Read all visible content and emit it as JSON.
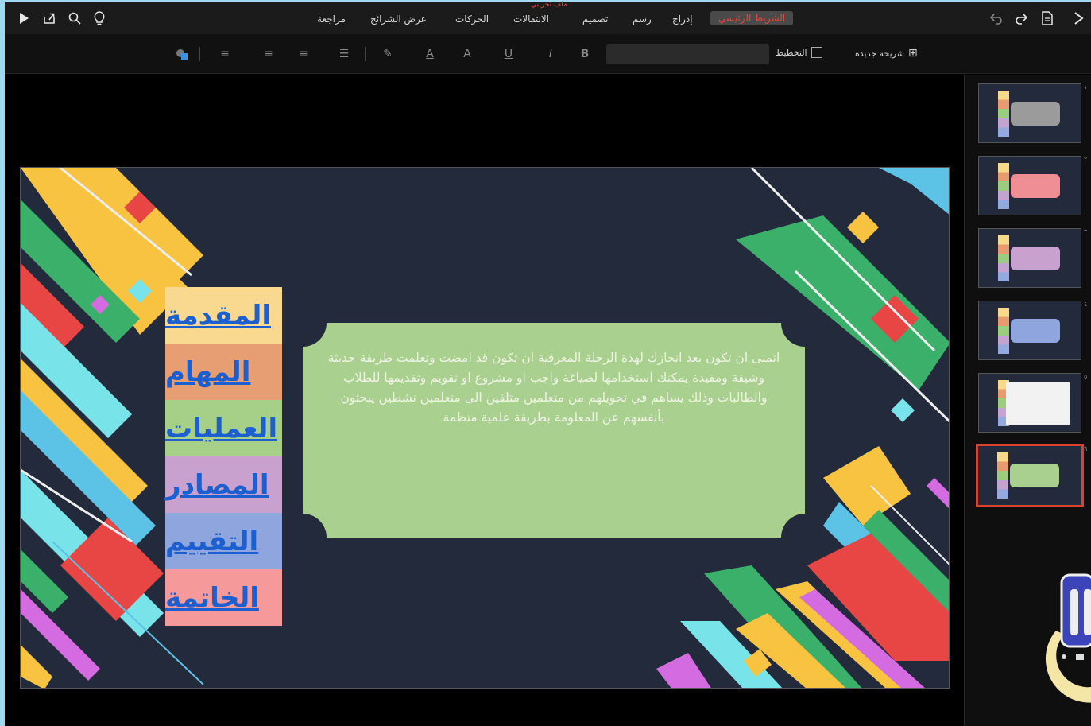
{
  "window": {
    "doc_title": "ملف تجريبي"
  },
  "topbar": {
    "tabs": [
      {
        "label": "الشريط الرئيسي",
        "active": true
      },
      {
        "label": "إدراج",
        "active": false
      },
      {
        "label": "رسم",
        "active": false
      },
      {
        "label": "تصميم",
        "active": false
      },
      {
        "label": "الانتقالات",
        "active": false
      },
      {
        "label": "الحركات",
        "active": false
      },
      {
        "label": "عرض الشرائح",
        "active": false
      },
      {
        "label": "مراجعة",
        "active": false
      }
    ],
    "icons": [
      "play-icon",
      "share-icon",
      "search-icon",
      "lightbulb-icon",
      "undo-icon",
      "redo-icon",
      "document-icon",
      "close-icon"
    ]
  },
  "ribbon": {
    "new_slide": "شريحة جديدة",
    "layout": "التخطيط",
    "bold": "B",
    "italic": "I",
    "underline": "U",
    "font_size_icon": "A",
    "font_color_icon": "A"
  },
  "slide": {
    "toc": [
      {
        "label": "المقدمة",
        "color": "#f9d98f"
      },
      {
        "label": "المهام",
        "color": "#e79e73"
      },
      {
        "label": "العمليات",
        "color": "#a6cf88"
      },
      {
        "label": "المصادر",
        "color": "#c9a1cf"
      },
      {
        "label": "التقييم",
        "color": "#8ea6dd"
      },
      {
        "label": "الخاتمة",
        "color": "#f6999a"
      }
    ],
    "body_text": "اتمنى ان تكون بعد انجازك لهذة الرحلة المعرفية ان تكون قد امضت وتعلمت طريقة حديثة وشيقة ومفيدة يمكنك استخدامها لصياغة واجب او مشروع او تقويم وتقديمها للطلاب والطالبات وذلك يساهم في تحويلهم من متعلمين متلقين الى متعلمين نشطين يبحثون بأنفسهم عن المعلومة بطريقة علمية منظمة",
    "textbox_color": "#a9d08e",
    "background_color": "#222a3b"
  },
  "panel": {
    "thumbnails": [
      {
        "num": "١",
        "box_color": "#9b9b9b",
        "selected": false
      },
      {
        "num": "٢",
        "box_color": "#ef8e95",
        "selected": false
      },
      {
        "num": "٣",
        "box_color": "#c9a1cf",
        "selected": false
      },
      {
        "num": "٤",
        "box_color": "#8ea6dd",
        "selected": false
      },
      {
        "num": "٥",
        "box_color": "#f2f2f2",
        "selected": false
      },
      {
        "num": "٦",
        "box_color": "#a9d08e",
        "selected": true
      }
    ]
  }
}
